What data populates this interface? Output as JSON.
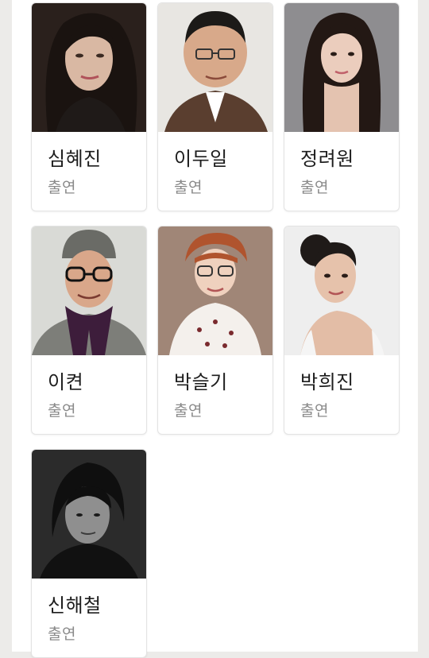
{
  "cast": [
    {
      "name": "심혜진",
      "role": "출연",
      "photo": "woman-dark-hair-portrait"
    },
    {
      "name": "이두일",
      "role": "출연",
      "photo": "man-glasses-plaid-jacket"
    },
    {
      "name": "정려원",
      "role": "출연",
      "photo": "woman-long-hair-gray-bg"
    },
    {
      "name": "이켠",
      "role": "출연",
      "photo": "man-beanie-scarf-glasses"
    },
    {
      "name": "박슬기",
      "role": "출연",
      "photo": "woman-glasses-heart-blouse"
    },
    {
      "name": "박희진",
      "role": "출연",
      "photo": "woman-updo-white-bg"
    },
    {
      "name": "신해철",
      "role": "출연",
      "photo": "man-dark-monochrome"
    }
  ]
}
